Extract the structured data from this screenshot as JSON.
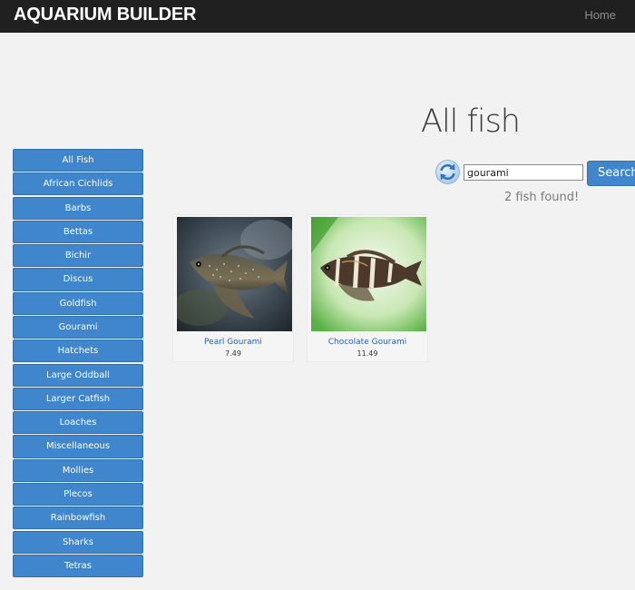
{
  "header": {
    "brand": "AQUARIUM BUILDER",
    "home_link": "Home"
  },
  "sidebar": {
    "categories": [
      {
        "label": "All Fish"
      },
      {
        "label": "African Cichlids"
      },
      {
        "label": "Barbs"
      },
      {
        "label": "Bettas"
      },
      {
        "label": "Bichir"
      },
      {
        "label": "Discus"
      },
      {
        "label": "Goldfish"
      },
      {
        "label": "Gourami"
      },
      {
        "label": "Hatchets"
      },
      {
        "label": "Large Oddball"
      },
      {
        "label": "Larger Catfish"
      },
      {
        "label": "Loaches"
      },
      {
        "label": "Miscellaneous"
      },
      {
        "label": "Mollies"
      },
      {
        "label": "Plecos"
      },
      {
        "label": "Rainbowfish"
      },
      {
        "label": "Sharks"
      },
      {
        "label": "Tetras"
      }
    ]
  },
  "main": {
    "title": "All fish",
    "search": {
      "value": "gourami",
      "button_label": "Search"
    },
    "result_count": "2 fish found!",
    "results": [
      {
        "name": "Pearl Gourami",
        "price": "7.49",
        "icon": "pearl-gourami-photo"
      },
      {
        "name": "Chocolate Gourami",
        "price": "11.49",
        "icon": "chocolate-gourami-photo"
      }
    ]
  },
  "icons": {
    "refresh": "refresh-icon"
  },
  "colors": {
    "navbar": "#202020",
    "accent": "#3f86cc",
    "background": "#f2f2f2",
    "link": "#2a5fb0"
  }
}
